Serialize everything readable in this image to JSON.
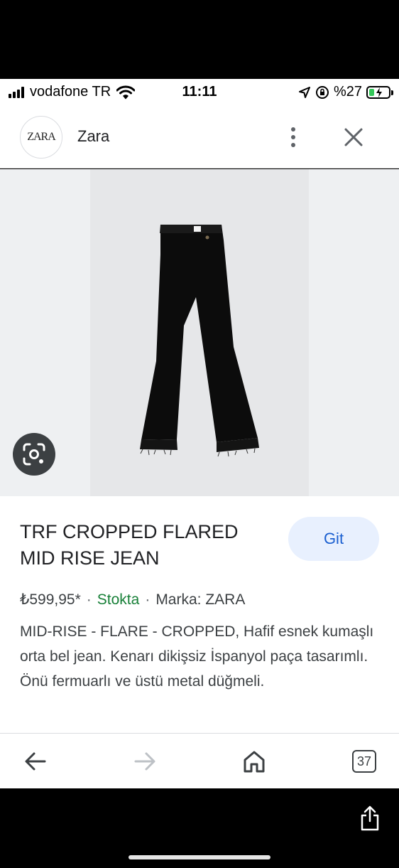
{
  "status_bar": {
    "carrier": "vodafone TR",
    "time": "11:11",
    "battery": "%27",
    "battery_level": 0.27
  },
  "header": {
    "logo_text": "ZARA",
    "site_name": "Zara"
  },
  "product": {
    "title": "TRF CROPPED FLARED MID RISE JEAN",
    "go_label": "Git",
    "price": "₺599,95*",
    "separator": "·",
    "stock": "Stokta",
    "brand": "Marka: ZARA",
    "description": "MID-RISE - FLARE - CROPPED, Hafif esnek kumaşlı orta bel jean. Kenarı dikişsiz İspanyol paça tasarımlı. Önü fermuarlı ve üstü metal düğmeli."
  },
  "bottom_nav": {
    "tab_count": "37"
  },
  "colors": {
    "accent": "#1a5fd0",
    "accent_bg": "#e8f0fe",
    "stock_green": "#188038",
    "battery_green": "#34c759"
  },
  "icons": [
    "signal-icon",
    "wifi-icon",
    "location-icon",
    "orientation-lock-icon",
    "battery-icon",
    "more-vert-icon",
    "close-icon",
    "google-lens-icon",
    "back-arrow-icon",
    "forward-arrow-icon",
    "home-icon",
    "tabs-icon",
    "share-icon"
  ]
}
